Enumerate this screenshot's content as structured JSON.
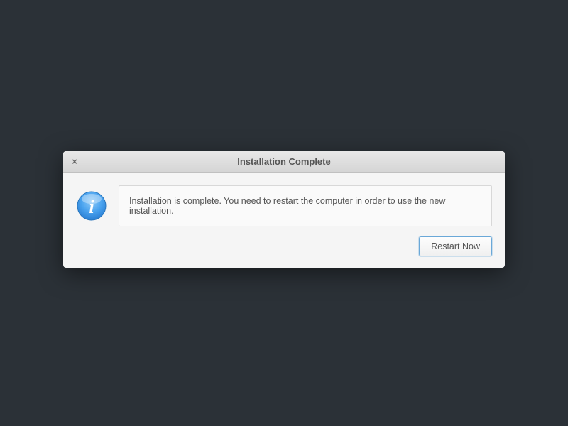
{
  "dialog": {
    "title": "Installation Complete",
    "message": "Installation is complete. You need to restart the computer in order to use the new installation.",
    "restart_button_label": "Restart Now",
    "close_symbol": "×"
  }
}
